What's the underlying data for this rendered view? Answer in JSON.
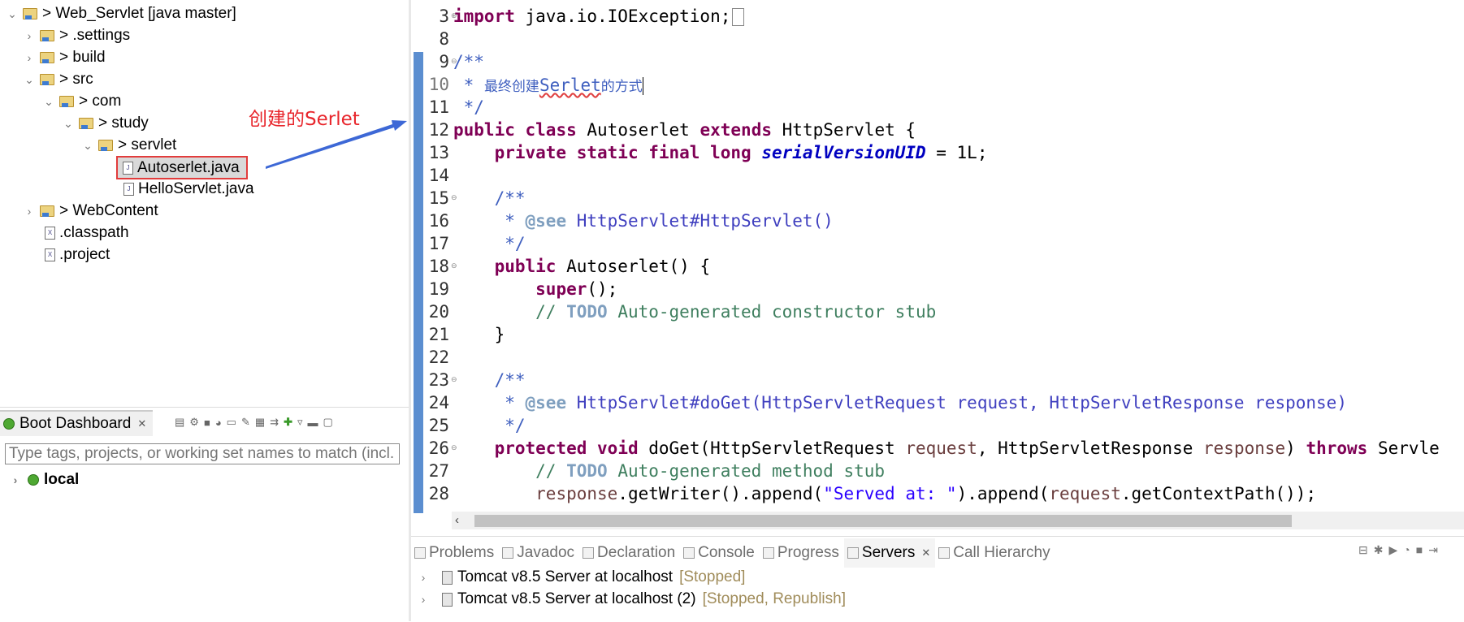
{
  "tree": {
    "items": [
      {
        "toggle": "⌄",
        "label": "> Web_Servlet [java master]",
        "kind": "project"
      },
      {
        "toggle": "›",
        "label": "> .settings",
        "kind": "folder"
      },
      {
        "toggle": "›",
        "label": "> build",
        "kind": "folder"
      },
      {
        "toggle": "⌄",
        "label": "> src",
        "kind": "folder"
      },
      {
        "toggle": "⌄",
        "label": "> com",
        "kind": "folder"
      },
      {
        "toggle": "⌄",
        "label": "> study",
        "kind": "folder"
      },
      {
        "toggle": "⌄",
        "label": "> servlet",
        "kind": "folder"
      },
      {
        "toggle": "",
        "label": "Autoserlet.java",
        "kind": "java"
      },
      {
        "toggle": "",
        "label": "HelloServlet.java",
        "kind": "java"
      },
      {
        "toggle": "›",
        "label": "> WebContent",
        "kind": "folder"
      },
      {
        "toggle": "",
        "label": ".classpath",
        "kind": "file"
      },
      {
        "toggle": "",
        "label": ".project",
        "kind": "file"
      }
    ],
    "callout": "创建的Serlet"
  },
  "dashboard": {
    "tab_label": "Boot Dashboard",
    "close": "✕",
    "filter_placeholder": "Type tags, projects, or working set names to match (incl.",
    "local_label": "local",
    "local_toggle": "›"
  },
  "editor": {
    "line_numbers": [
      "3",
      "8",
      "9",
      "10",
      "11",
      "12",
      "13",
      "14",
      "15",
      "16",
      "17",
      "18",
      "19",
      "20",
      "21",
      "22",
      "23",
      "24",
      "25",
      "26",
      "27",
      "28"
    ],
    "line1": {
      "kw": "import",
      "rest": " java.io.IOException;"
    },
    "line9": "/**",
    "line10": {
      "star": " * ",
      "cjk1": "最终创建",
      "word": "Serlet",
      "cjk2": "的方式"
    },
    "line11": " */",
    "line12": {
      "kw1": "public",
      "kw2": "class",
      "name": "Autoserlet",
      "kw3": "extends",
      "rest": "HttpServlet {"
    },
    "line13": {
      "kw": "private static final long",
      "field": "serialVersionUID",
      "rest": " = 1L;"
    },
    "line15": "/**",
    "line16": {
      "star": " * ",
      "tag": "@see",
      "ref": " HttpServlet#HttpServlet()"
    },
    "line17": " */",
    "line18": {
      "kw": "public",
      "rest": " Autoserlet() {"
    },
    "line19": {
      "kw": "super",
      "rest": "();"
    },
    "line20": {
      "slash": "// ",
      "todo": "TODO",
      "rest": " Auto-generated constructor stub"
    },
    "line21": "}",
    "line23": "/**",
    "line24": {
      "star": " * ",
      "tag": "@see",
      "ref": " HttpServlet#doGet(HttpServletRequest request, HttpServletResponse response)"
    },
    "line25": " */",
    "line26": {
      "kw1": "protected",
      "kw2": "void",
      "name": " doGet(HttpServletRequest ",
      "p1": "request",
      "mid": ", HttpServletResponse ",
      "p2": "response",
      "close": ") ",
      "kw3": "throws",
      "rest": " Servle"
    },
    "line27": {
      "slash": "// ",
      "todo": "TODO",
      "rest": " Auto-generated method stub"
    },
    "line28": {
      "p1": "response",
      "a": ".getWriter().append(",
      "str": "\"Served at: \"",
      "b": ").append(",
      "p2": "request",
      "c": ".getContextPath());"
    }
  },
  "bottom": {
    "tabs": [
      {
        "label": "Problems",
        "active": false
      },
      {
        "label": "Javadoc",
        "active": false
      },
      {
        "label": "Declaration",
        "active": false
      },
      {
        "label": "Console",
        "active": false
      },
      {
        "label": "Progress",
        "active": false
      },
      {
        "label": "Servers",
        "active": true
      },
      {
        "label": "Call Hierarchy",
        "active": false
      }
    ],
    "servers": [
      {
        "name": "Tomcat v8.5 Server at localhost",
        "status": "[Stopped]"
      },
      {
        "name": "Tomcat v8.5 Server at localhost (2)",
        "status": "[Stopped, Republish]"
      }
    ],
    "close": "✕"
  }
}
